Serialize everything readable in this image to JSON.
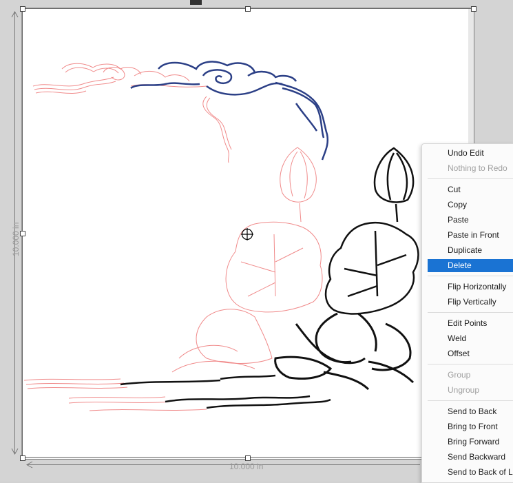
{
  "canvas": {
    "width_label": "10.000 in",
    "height_label": "10.000 in"
  },
  "context_menu": {
    "items": [
      {
        "label": "Undo Edit",
        "enabled": true
      },
      {
        "label": "Nothing to Redo",
        "enabled": false
      },
      {
        "label": "Cut",
        "enabled": true
      },
      {
        "label": "Copy",
        "enabled": true
      },
      {
        "label": "Paste",
        "enabled": true
      },
      {
        "label": "Paste in Front",
        "enabled": true
      },
      {
        "label": "Duplicate",
        "enabled": true
      },
      {
        "label": "Delete",
        "enabled": true,
        "highlighted": true
      },
      {
        "label": "Flip Horizontally",
        "enabled": true
      },
      {
        "label": "Flip Vertically",
        "enabled": true
      },
      {
        "label": "Edit Points",
        "enabled": true
      },
      {
        "label": "Weld",
        "enabled": true
      },
      {
        "label": "Offset",
        "enabled": true
      },
      {
        "label": "Group",
        "enabled": false
      },
      {
        "label": "Ungroup",
        "enabled": false
      },
      {
        "label": "Send to Back",
        "enabled": true
      },
      {
        "label": "Bring to Front",
        "enabled": true
      },
      {
        "label": "Bring Forward",
        "enabled": true
      },
      {
        "label": "Send Backward",
        "enabled": true
      },
      {
        "label": "Send to Back of La",
        "enabled": true
      }
    ],
    "highlight_color": "#1a73d3"
  },
  "artwork": {
    "outline_color": "#f08a8a",
    "cloud_color": "#2b3f86",
    "ink_color": "#111111"
  },
  "icons": [
    "crosshair-cursor-icon"
  ]
}
